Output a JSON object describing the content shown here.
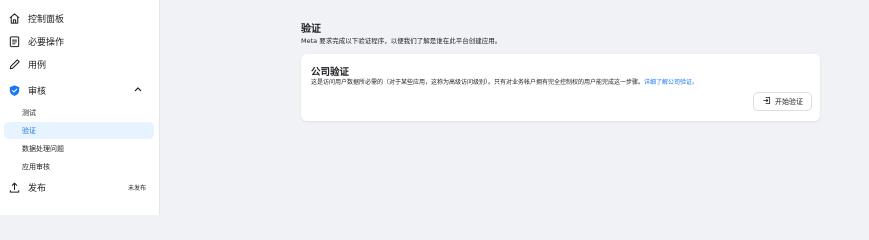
{
  "sidebar": {
    "items": [
      {
        "label": "控制面板",
        "icon": "home-icon"
      },
      {
        "label": "必要操作",
        "icon": "clipboard-icon"
      },
      {
        "label": "用例",
        "icon": "pencil-icon"
      },
      {
        "label": "审核",
        "icon": "shield-check-icon",
        "expanded": true
      },
      {
        "label": "发布",
        "icon": "upload-icon",
        "badge": "未发布"
      }
    ],
    "review_subitems": [
      {
        "label": "测试"
      },
      {
        "label": "验证",
        "active": true
      },
      {
        "label": "数据处理问题"
      },
      {
        "label": "应用审核"
      }
    ]
  },
  "main": {
    "title": "验证",
    "description": "Meta 要求完成以下验证程序，以便我们了解是谁在此平台创建应用。",
    "card": {
      "title": "公司验证",
      "description": "这是访问用户数据所必需的（对于某些应用，这称为高级访问级别）。只有对业务帐户拥有完全控制权的用户能完成这一步骤。",
      "link_text": "详细了解公司验证。",
      "button_label": "开始验证"
    }
  },
  "colors": {
    "accent": "#1877f2",
    "active_bg": "#e7f3ff",
    "page_bg": "#f0f2f5"
  }
}
